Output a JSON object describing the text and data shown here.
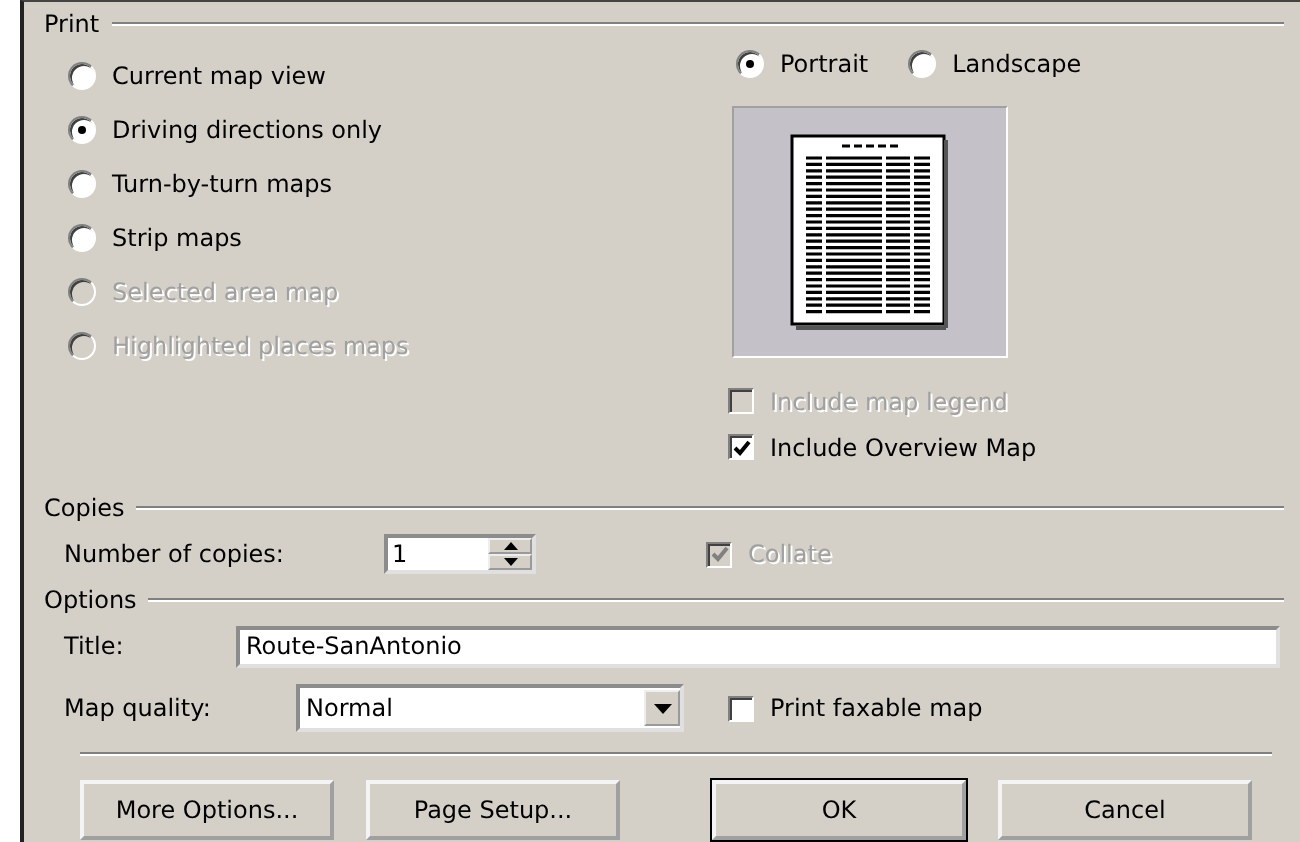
{
  "print": {
    "legend": "Print",
    "options": [
      {
        "label": "Current map view",
        "selected": false,
        "disabled": false
      },
      {
        "label": "Driving directions only",
        "selected": true,
        "disabled": false
      },
      {
        "label": "Turn-by-turn maps",
        "selected": false,
        "disabled": false
      },
      {
        "label": "Strip maps",
        "selected": false,
        "disabled": false
      },
      {
        "label": "Selected area map",
        "selected": false,
        "disabled": true
      },
      {
        "label": "Highlighted places maps",
        "selected": false,
        "disabled": true
      }
    ],
    "orientation": [
      {
        "label": "Portrait",
        "selected": true
      },
      {
        "label": "Landscape",
        "selected": false
      }
    ],
    "checkboxes": [
      {
        "label": "Include map legend",
        "checked": false,
        "disabled": true
      },
      {
        "label": "Include Overview Map",
        "checked": true,
        "disabled": false
      }
    ]
  },
  "copies": {
    "legend": "Copies",
    "label": "Number of copies:",
    "value": "1",
    "collate": {
      "label": "Collate",
      "checked": true,
      "disabled": true
    }
  },
  "options": {
    "legend": "Options",
    "title_label": "Title:",
    "title_value": "Route-SanAntonio",
    "quality_label": "Map quality:",
    "quality_value": "Normal",
    "faxable": {
      "label": "Print faxable map",
      "checked": false,
      "disabled": false
    }
  },
  "buttons": [
    {
      "label": "More Options...",
      "default": false
    },
    {
      "label": "Page Setup...",
      "default": false
    },
    {
      "label": "OK",
      "default": true
    },
    {
      "label": "Cancel",
      "default": false
    }
  ]
}
